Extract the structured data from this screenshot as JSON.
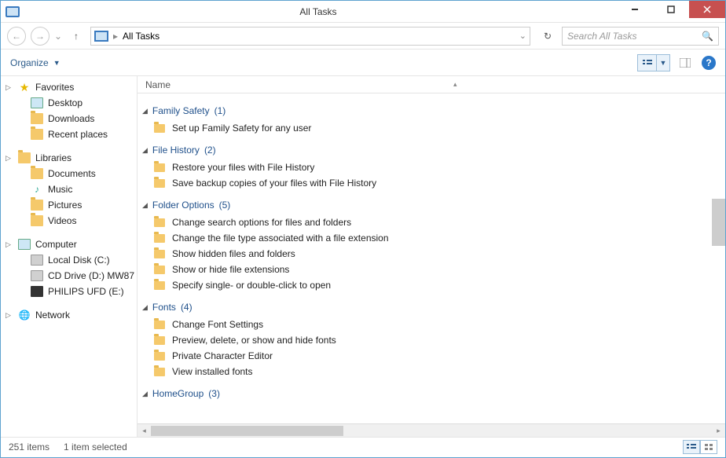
{
  "window": {
    "title": "All Tasks"
  },
  "nav": {
    "location": "All Tasks"
  },
  "search": {
    "placeholder": "Search All Tasks"
  },
  "toolbar": {
    "organize": "Organize"
  },
  "column": {
    "name": "Name"
  },
  "sidebar": {
    "favorites": {
      "label": "Favorites",
      "items": [
        {
          "label": "Desktop"
        },
        {
          "label": "Downloads"
        },
        {
          "label": "Recent places"
        }
      ]
    },
    "libraries": {
      "label": "Libraries",
      "items": [
        {
          "label": "Documents"
        },
        {
          "label": "Music"
        },
        {
          "label": "Pictures"
        },
        {
          "label": "Videos"
        }
      ]
    },
    "computer": {
      "label": "Computer",
      "items": [
        {
          "label": "Local Disk (C:)"
        },
        {
          "label": "CD Drive (D:) MW87"
        },
        {
          "label": "PHILIPS UFD (E:)"
        }
      ]
    },
    "network": {
      "label": "Network"
    }
  },
  "groups": [
    {
      "name": "Family Safety",
      "count": 1,
      "tasks": [
        "Set up Family Safety for any user"
      ]
    },
    {
      "name": "File History",
      "count": 2,
      "tasks": [
        "Restore your files with File History",
        "Save backup copies of your files with File History"
      ]
    },
    {
      "name": "Folder Options",
      "count": 5,
      "tasks": [
        "Change search options for files and folders",
        "Change the file type associated with a file extension",
        "Show hidden files and folders",
        "Show or hide file extensions",
        "Specify single- or double-click to open"
      ]
    },
    {
      "name": "Fonts",
      "count": 4,
      "tasks": [
        "Change Font Settings",
        "Preview, delete, or show and hide fonts",
        "Private Character Editor",
        "View installed fonts"
      ]
    },
    {
      "name": "HomeGroup",
      "count": 3,
      "tasks": []
    }
  ],
  "status": {
    "total": "251 items",
    "selected": "1 item selected"
  }
}
